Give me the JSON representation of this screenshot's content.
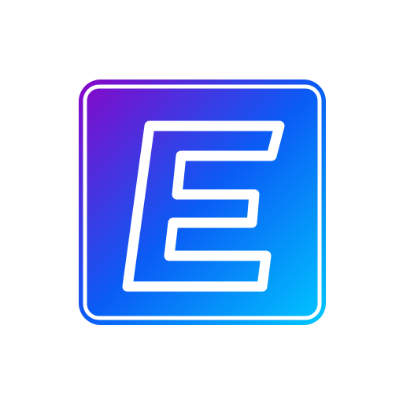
{
  "logo": {
    "name": "E",
    "letter": "E",
    "colors": {
      "gradient_start": "#8A05C8",
      "gradient_mid": "#0A5CF5",
      "gradient_end": "#00C8FF",
      "outline": "#ffffff",
      "background": "#ffffff"
    }
  }
}
